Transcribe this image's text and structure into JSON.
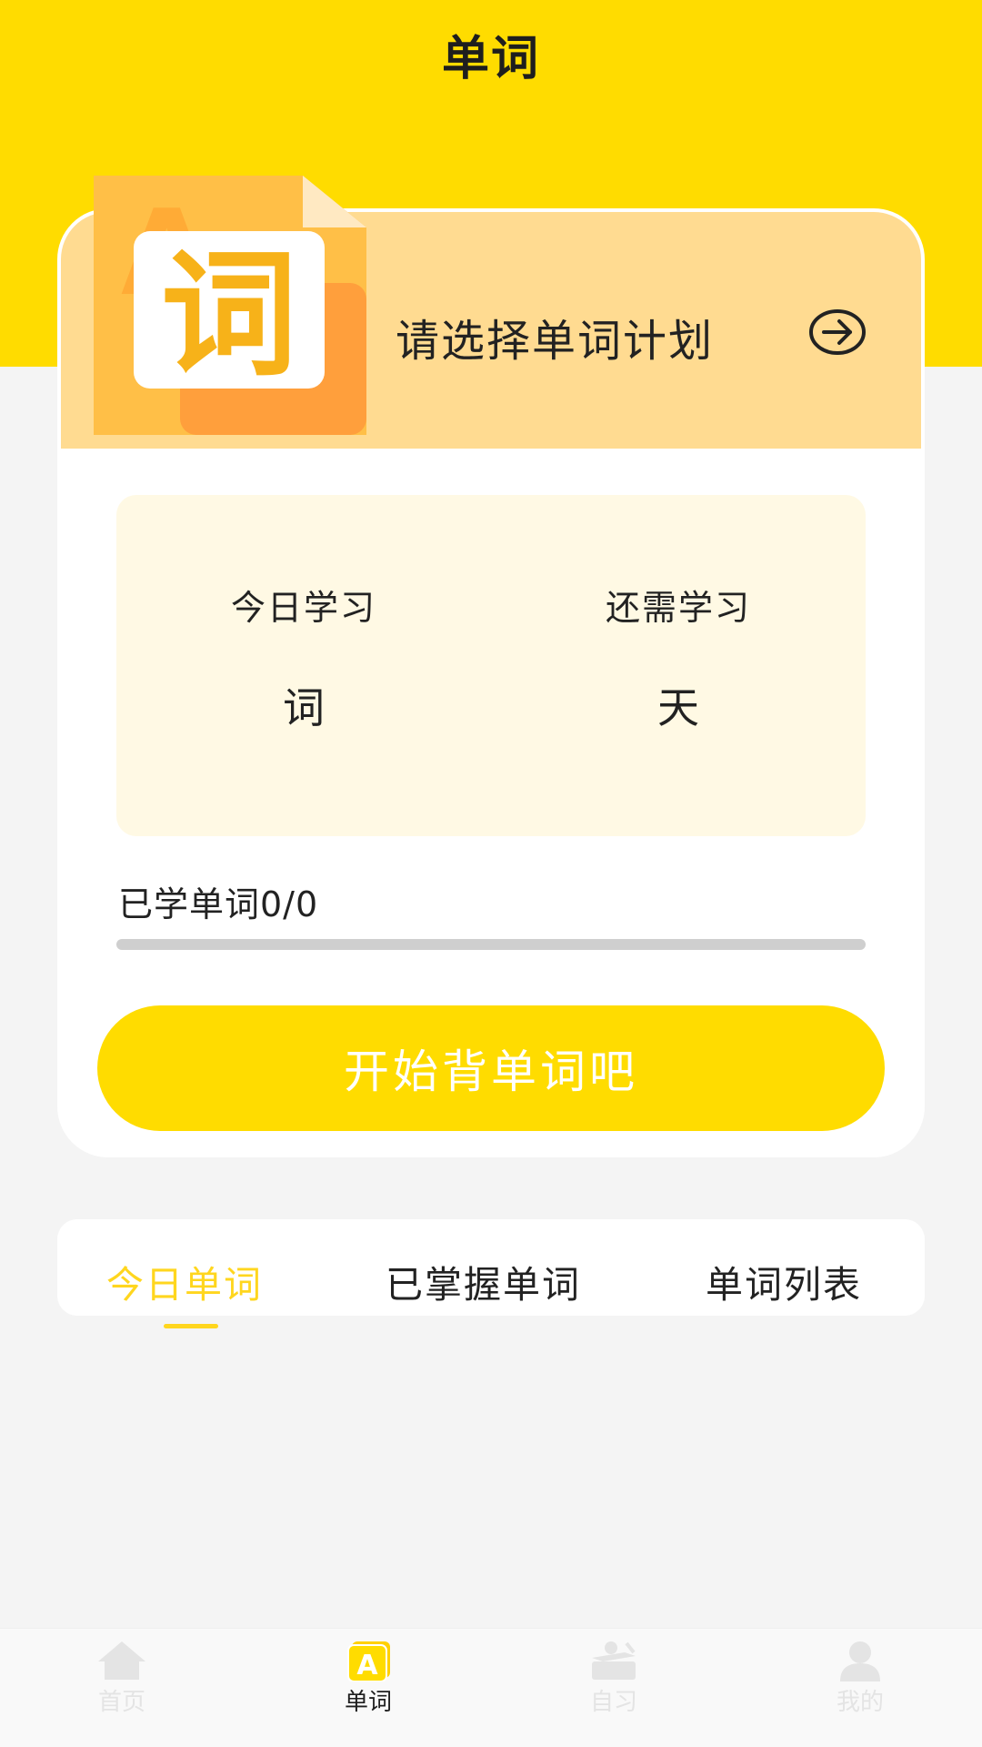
{
  "header": {
    "title": "单词"
  },
  "plan": {
    "prompt": "请选择单词计划",
    "badge_char": "词",
    "badge_letter": "A"
  },
  "stats": {
    "today_label": "今日学习",
    "today_unit": "词",
    "remaining_label": "还需学习",
    "remaining_unit": "天"
  },
  "progress": {
    "learned_text": "已学单词0/0",
    "learned": 0,
    "total": 0
  },
  "start_button": {
    "label": "开始背单词吧"
  },
  "tabs": [
    {
      "label": "今日单词",
      "active": true
    },
    {
      "label": "已掌握单词",
      "active": false
    },
    {
      "label": "单词列表",
      "active": false
    }
  ],
  "bottom_nav": [
    {
      "label": "首页",
      "icon": "home-icon",
      "active": false
    },
    {
      "label": "单词",
      "icon": "word-icon",
      "active": true,
      "icon_text": "A"
    },
    {
      "label": "自习",
      "icon": "study-desk-icon",
      "active": false
    },
    {
      "label": "我的",
      "icon": "user-icon",
      "active": false
    }
  ],
  "colors": {
    "accent": "#ffdc00",
    "banner": "#ffdb91",
    "stats_bg": "#fff9e4",
    "inactive_nav": "#e4e4e4",
    "tab_active": "#ffd61e"
  }
}
